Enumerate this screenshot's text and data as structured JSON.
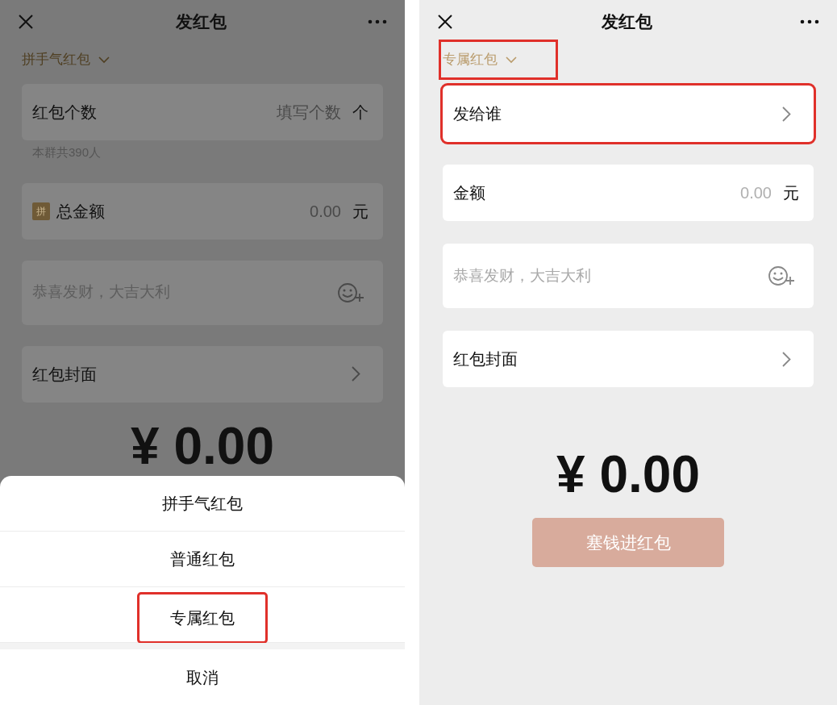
{
  "screens": [
    {
      "dimmed": true,
      "title": "发红包",
      "type_selector": {
        "label": "拼手气红包",
        "highlighted": false
      },
      "fields": [
        {
          "kind": "input",
          "label": "红包个数",
          "placeholder": "填写个数",
          "unit": "个",
          "note": "本群共390人",
          "highlighted": false
        },
        {
          "kind": "input",
          "badge": "拼",
          "label": "总金额",
          "placeholder": "0.00",
          "unit": "元",
          "highlighted": false
        },
        {
          "kind": "message",
          "placeholder": "恭喜发财，大吉大利",
          "highlighted": false
        },
        {
          "kind": "link",
          "label": "红包封面",
          "highlighted": false
        }
      ],
      "amount": "¥ 0.00",
      "action_sheet": {
        "options": [
          {
            "label": "拼手气红包",
            "highlighted": false
          },
          {
            "label": "普通红包",
            "highlighted": false
          },
          {
            "label": "专属红包",
            "highlighted": true
          }
        ],
        "cancel": "取消"
      }
    },
    {
      "dimmed": false,
      "title": "发红包",
      "type_selector": {
        "label": "专属红包",
        "highlighted": true
      },
      "fields": [
        {
          "kind": "link",
          "label": "发给谁",
          "highlighted": true
        },
        {
          "kind": "input",
          "label": "金额",
          "placeholder": "0.00",
          "unit": "元",
          "highlighted": false
        },
        {
          "kind": "message",
          "placeholder": "恭喜发财，大吉大利",
          "highlighted": false
        },
        {
          "kind": "link",
          "label": "红包封面",
          "highlighted": false
        }
      ],
      "amount": "¥ 0.00",
      "submit": {
        "label": "塞钱进红包",
        "disabled": true
      }
    }
  ]
}
